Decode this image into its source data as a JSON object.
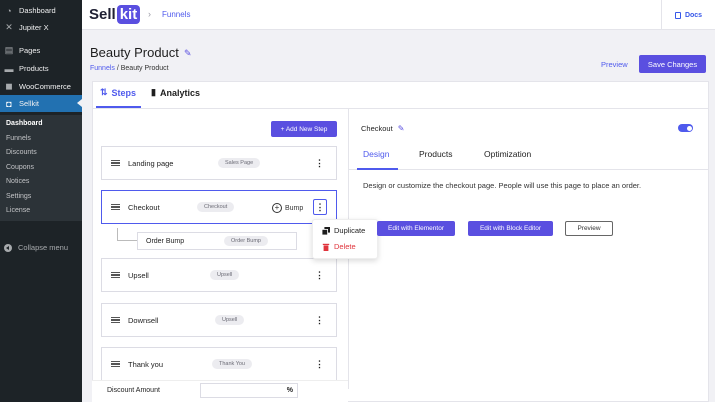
{
  "wp_menu": {
    "items": [
      {
        "label": "Dashboard",
        "icon": "dashboard-icon"
      },
      {
        "label": "Jupiter X",
        "icon": "jupiter-icon"
      },
      {
        "label": "Pages",
        "icon": "pages-icon"
      },
      {
        "label": "Products",
        "icon": "products-icon"
      },
      {
        "label": "WooCommerce",
        "icon": "woocommerce-icon"
      },
      {
        "label": "Sellkit",
        "icon": "sellkit-icon"
      }
    ],
    "sub_items": [
      "Dashboard",
      "Funnels",
      "Discounts",
      "Coupons",
      "Notices",
      "Settings",
      "License"
    ],
    "collapse_label": "Collapse menu"
  },
  "topbar": {
    "logo_text": "Sell",
    "logo_badge": "kit",
    "breadcrumb_sep": "›",
    "breadcrumb": "Funnels",
    "docs_label": "Docs"
  },
  "header": {
    "title": "Beauty Product",
    "breadcrumb_link": "Funnels",
    "breadcrumb_current": "/ Beauty Product",
    "preview_label": "Preview",
    "save_label": "Save Changes"
  },
  "tabs": {
    "steps": "Steps",
    "analytics": "Analytics"
  },
  "add_step_label": "+ Add New Step",
  "steps": [
    {
      "name": "Landing page",
      "badge": "Sales Page"
    },
    {
      "name": "Checkout",
      "badge": "Checkout",
      "bump_label": "Bump"
    },
    {
      "name": "Upsell",
      "badge": "Upsell"
    },
    {
      "name": "Downsell",
      "badge": "Upsell"
    },
    {
      "name": "Thank you",
      "badge": "Thank You"
    }
  ],
  "order_bump": {
    "name": "Order Bump",
    "badge": "Order Bump"
  },
  "dropdown": {
    "duplicate": "Duplicate",
    "delete": "Delete"
  },
  "discount": {
    "label": "Discount Amount",
    "unit": "%"
  },
  "right_panel": {
    "title": "Checkout",
    "toggle_on": true,
    "tabs": [
      "Design",
      "Products",
      "Optimization"
    ],
    "description": "Design or customize the checkout page. People will use this page to place an order.",
    "buttons": {
      "elementor": "Edit with Elementor",
      "block": "Edit with Block Editor",
      "preview": "Preview"
    }
  },
  "colors": {
    "accent": "#5a4fe0",
    "wp_sidebar": "#1d2327",
    "wp_active": "#2271b1",
    "danger": "#e0343c"
  }
}
